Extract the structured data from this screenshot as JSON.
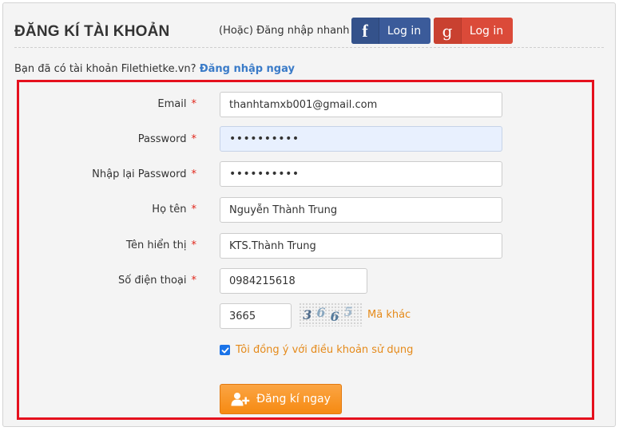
{
  "header": {
    "title": "ĐĂNG KÍ TÀI KHOẢN",
    "quick_login_text": "(Hoặc) Đăng nhập nhanh",
    "facebook_glyph": "f",
    "facebook_label": "Log in",
    "google_glyph": "g",
    "google_label": "Log in"
  },
  "login_prompt": {
    "text": "Bạn đã có tài khoản Filethietke.vn?",
    "link": "Đăng nhập ngay"
  },
  "form": {
    "required_mark": "*",
    "email_label": "Email",
    "email_value": "thanhtamxb001@gmail.com",
    "password_label": "Password",
    "password_value": "••••••••••",
    "confirm_label": "Nhập lại Password",
    "confirm_value": "••••••••••",
    "fullname_label": "Họ tên",
    "fullname_value": "Nguyễn Thành Trung",
    "display_label": "Tên hiển thị",
    "display_value": "KTS.Thành Trung",
    "phone_label": "Số điện thoại",
    "phone_value": "0984215618",
    "captcha_value": "3665",
    "captcha_chars": [
      "3",
      "6",
      "6",
      "5"
    ],
    "other_code": "Mã khác",
    "agree_text": "Tôi đồng ý với điều khoản sử dụng",
    "submit_label": "Đăng kí ngay"
  },
  "colors": {
    "facebook": "#3b5b9a",
    "google": "#db4a39",
    "accent_orange": "#f68a12",
    "link_blue": "#3a7bc8",
    "highlight_red": "#e5101d"
  },
  "icons": {
    "submit": "add-user-icon",
    "checkbox": "checkmark-icon"
  }
}
